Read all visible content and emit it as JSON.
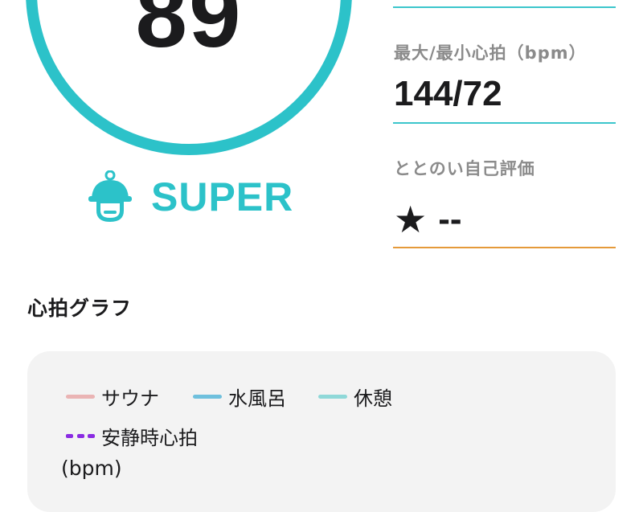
{
  "score": {
    "value": "89",
    "rank": "SUPER",
    "ring_color": "#2cc2c9"
  },
  "stats": {
    "top_value_fragment": "/",
    "heart_rate": {
      "label": "最大/最小心拍（bpm）",
      "value": "144/72"
    },
    "self_rating": {
      "label": "ととのい自己評価",
      "star": "★",
      "value": "--"
    },
    "colors": {
      "divider": "#3cc6cc",
      "rating_divider": "#e59a3a"
    }
  },
  "graph": {
    "title": "心拍グラフ",
    "unit": "(bpm)",
    "legend": [
      {
        "label": "サウナ",
        "color": "#eab4b4"
      },
      {
        "label": "水風呂",
        "color": "#6fc0dd"
      },
      {
        "label": "休憩",
        "color": "#8fd8d8"
      },
      {
        "label": "安静時心拍",
        "color": "#8a2be2",
        "style": "dashed"
      }
    ]
  }
}
